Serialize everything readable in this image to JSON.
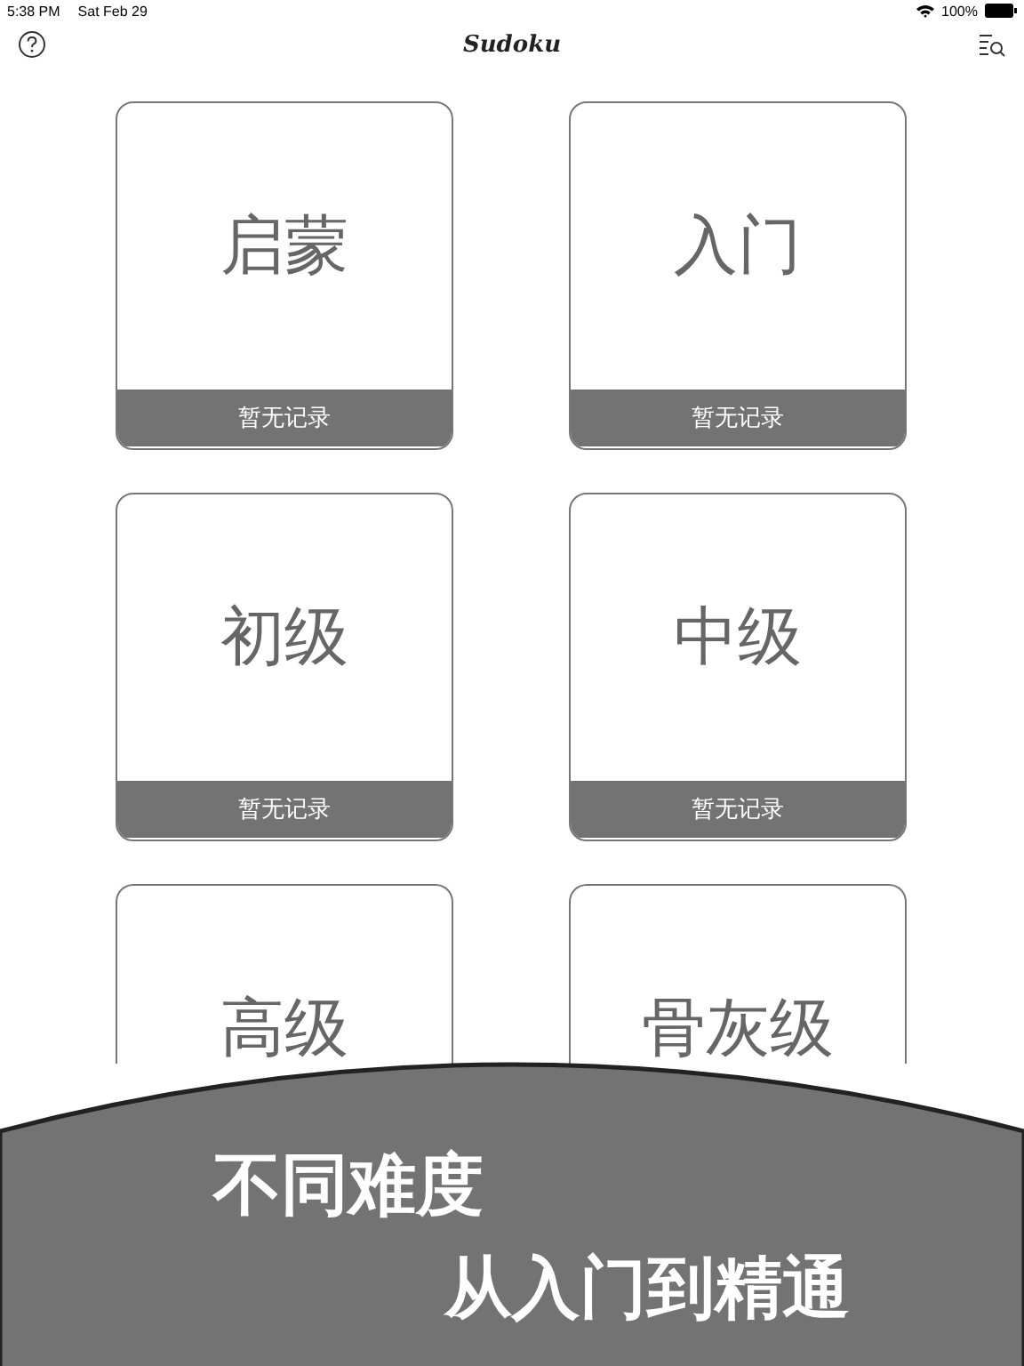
{
  "status_bar": {
    "time": "5:38 PM",
    "date": "Sat Feb 29",
    "battery": "100%"
  },
  "nav": {
    "title": "Sudoku"
  },
  "levels": [
    {
      "title": "启蒙",
      "record": "暂无记录"
    },
    {
      "title": "入门",
      "record": "暂无记录"
    },
    {
      "title": "初级",
      "record": "暂无记录"
    },
    {
      "title": "中级",
      "record": "暂无记录"
    },
    {
      "title": "高级"
    },
    {
      "title": "骨灰级"
    }
  ],
  "banner": {
    "line_1": "不同难度",
    "line_2": "从入门到精通"
  }
}
